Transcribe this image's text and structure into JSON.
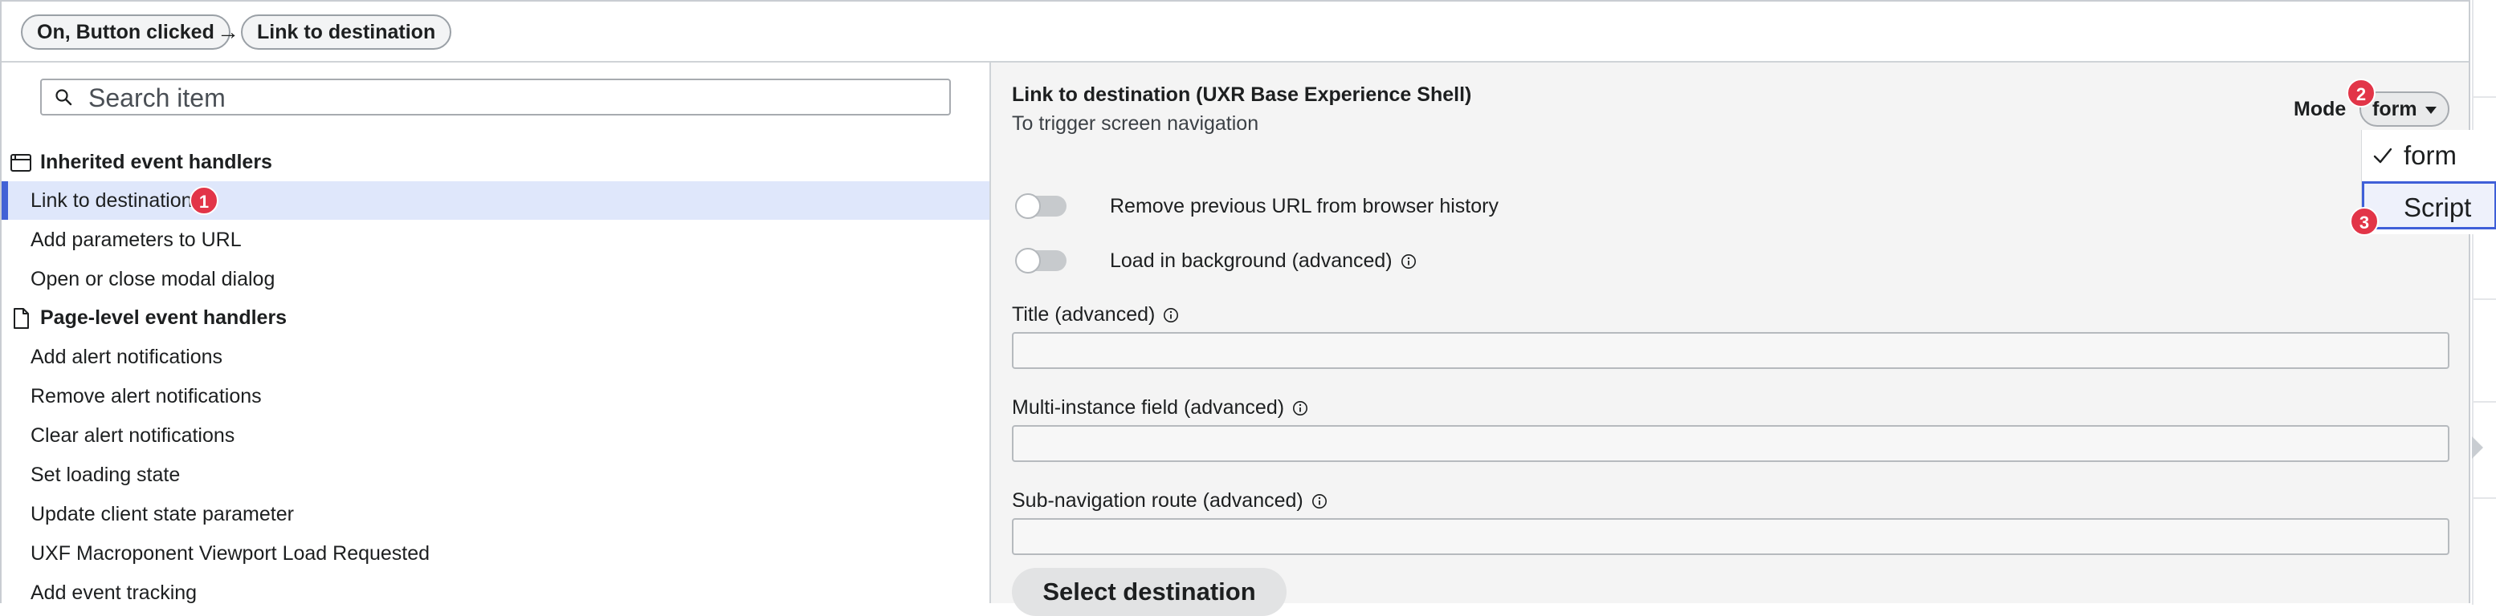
{
  "breadcrumb": {
    "trigger": "On, Button clicked",
    "arrow": "→",
    "action": "Link to destination"
  },
  "search": {
    "placeholder": "Search item"
  },
  "sidebar": {
    "inherited_heading": "Inherited event handlers",
    "inherited_items": [
      "Link to destination",
      "Add parameters to URL",
      "Open or close modal dialog"
    ],
    "page_heading": "Page-level event handlers",
    "page_items": [
      "Add alert notifications",
      "Remove alert notifications",
      "Clear alert notifications",
      "Set loading state",
      "Update client state parameter",
      "UXF Macroponent Viewport Load Requested",
      "Add event tracking"
    ]
  },
  "badges": {
    "one": "1",
    "two": "2",
    "three": "3"
  },
  "panel": {
    "title": "Link to destination (UXR Base Experience Shell)",
    "subtitle": "To trigger screen navigation",
    "mode_label": "Mode",
    "mode_value": "form",
    "toggles": [
      {
        "label": "Remove previous URL from browser history",
        "on": false
      },
      {
        "label": "Load in background (advanced)",
        "on": false
      }
    ],
    "fields": [
      {
        "label": "Title (advanced)",
        "value": ""
      },
      {
        "label": "Multi-instance field (advanced)",
        "value": ""
      },
      {
        "label": "Sub-navigation route (advanced)",
        "value": ""
      }
    ],
    "destination_button": "Select destination"
  },
  "mode_menu": {
    "options": [
      "form",
      "Script"
    ],
    "checked": "form",
    "focused": "Script"
  },
  "colors": {
    "accent": "#4262d6",
    "selected_bg": "#dfe7fb",
    "badge": "#e23548",
    "panel_bg": "#f4f4f4"
  }
}
